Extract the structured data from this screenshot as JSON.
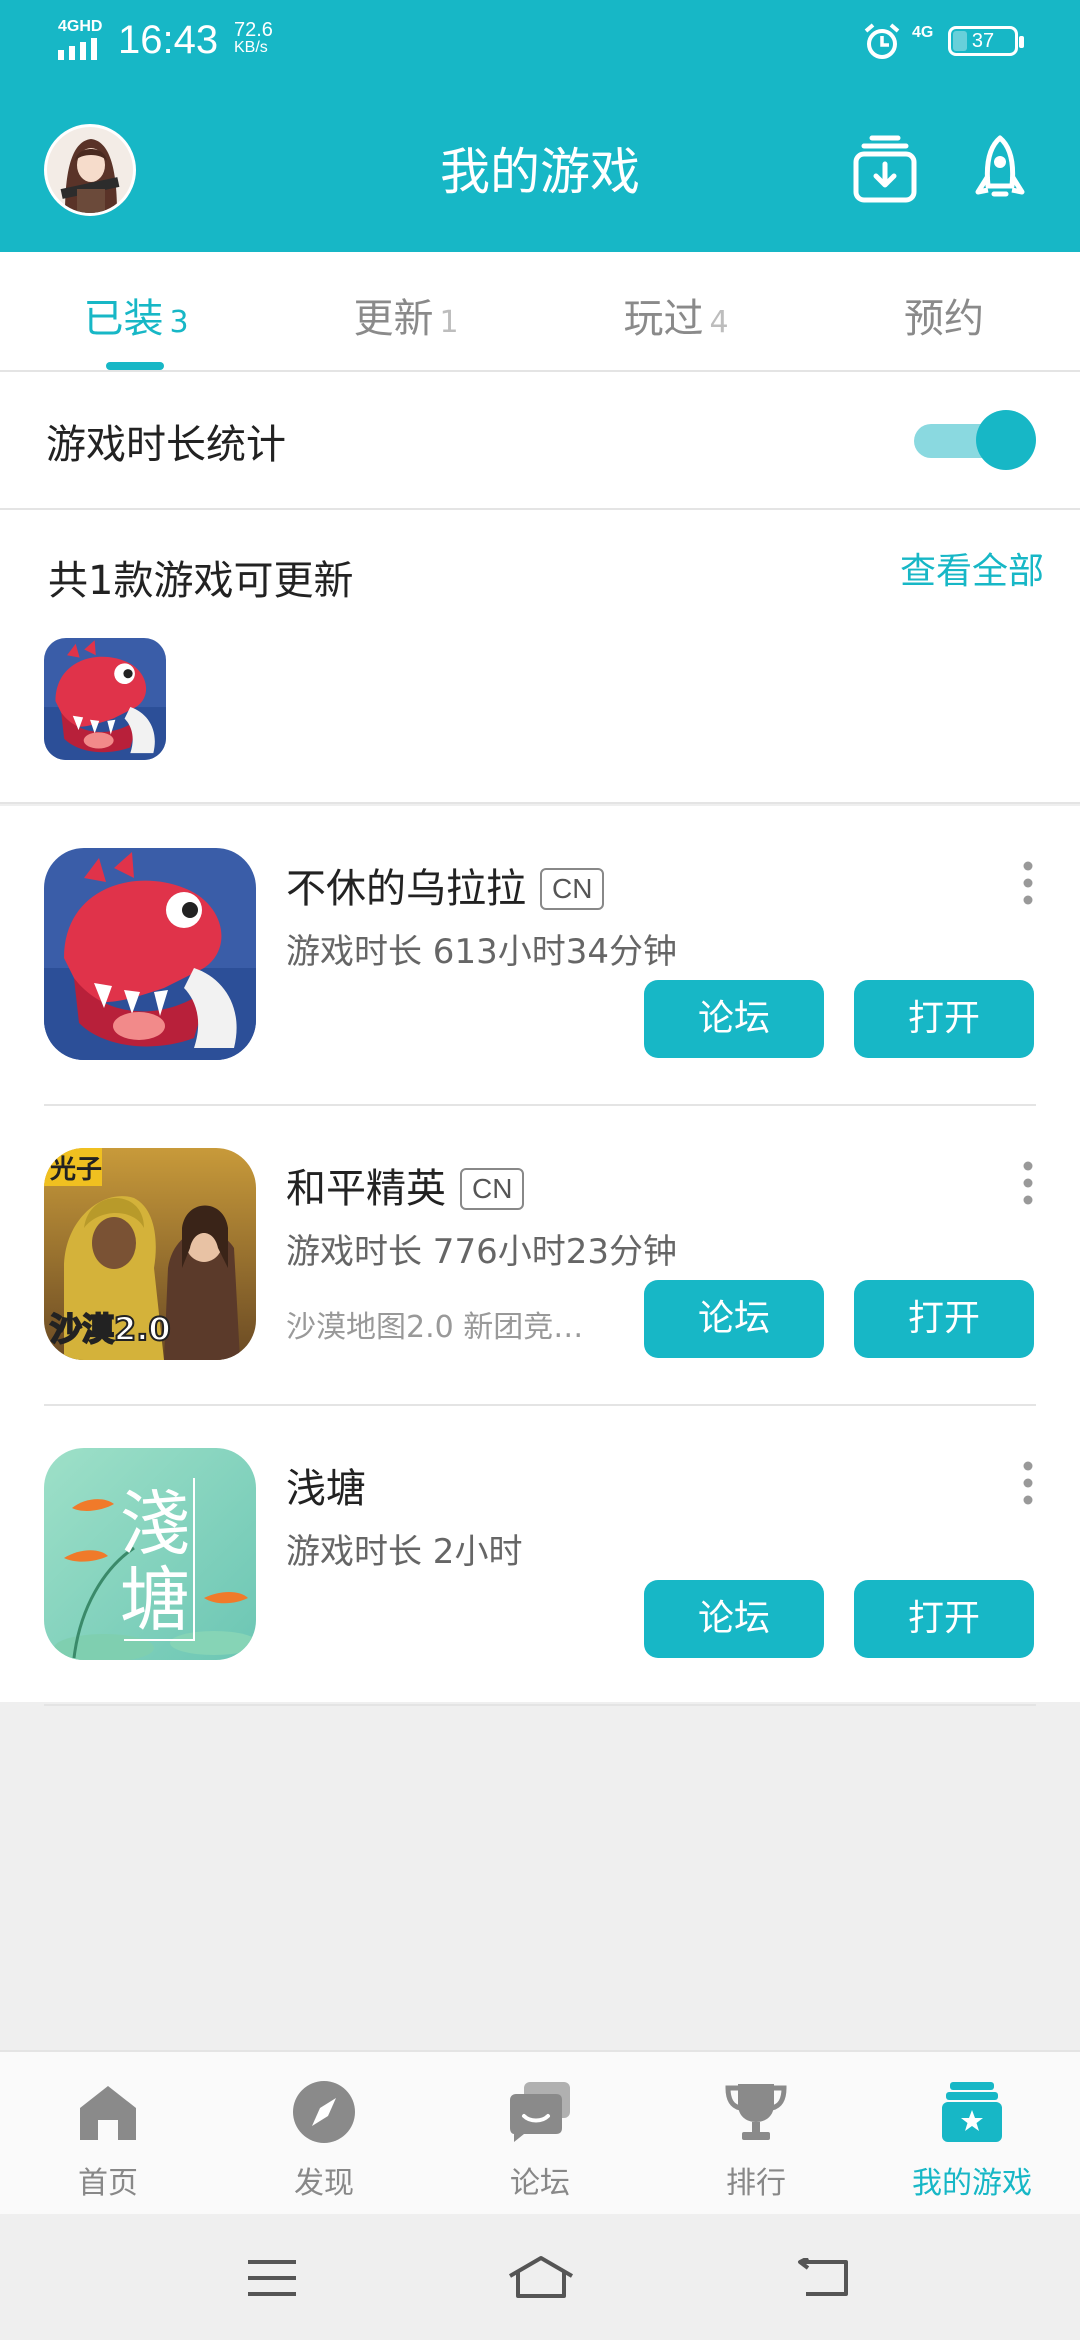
{
  "status_bar": {
    "network_label": "4GHD",
    "time": "16:43",
    "speed_value": "72.6",
    "speed_unit": "KB/s",
    "network_right": "4G",
    "battery": "37",
    "battery_level_pct": 37
  },
  "header": {
    "title": "我的游戏",
    "bg_color": "#17b7c6"
  },
  "tabs": [
    {
      "label": "已装",
      "count": "3",
      "active": true
    },
    {
      "label": "更新",
      "count": "1",
      "active": false
    },
    {
      "label": "玩过",
      "count": "4",
      "active": false
    },
    {
      "label": "预约",
      "count": "",
      "active": false
    }
  ],
  "stats": {
    "label": "游戏时长统计",
    "toggle_on": true
  },
  "update_section": {
    "title": "共1款游戏可更新",
    "view_all": "查看全部"
  },
  "games": [
    {
      "name": "不休的乌拉拉",
      "badge": "CN",
      "time": "游戏时长 613小时34分钟",
      "subtitle": "",
      "forum": "论坛",
      "open": "打开"
    },
    {
      "name": "和平精英",
      "badge": "CN",
      "time": "游戏时长 776小时23分钟",
      "subtitle": "沙漠地图2.0 新团竞…",
      "forum": "论坛",
      "open": "打开"
    },
    {
      "name": "浅塘",
      "badge": "",
      "time": "游戏时长 2小时",
      "subtitle": "",
      "forum": "论坛",
      "open": "打开",
      "icon_text": "淺塘"
    }
  ],
  "game_art": {
    "pubg_tag": "光子",
    "pubg_map": "沙漠2.0"
  },
  "bottom_nav": [
    {
      "label": "首页",
      "icon": "home-icon",
      "active": false
    },
    {
      "label": "发现",
      "icon": "compass-icon",
      "active": false
    },
    {
      "label": "论坛",
      "icon": "forum-icon",
      "active": false
    },
    {
      "label": "排行",
      "icon": "trophy-icon",
      "active": false
    },
    {
      "label": "我的游戏",
      "icon": "my-games-icon",
      "active": true
    }
  ],
  "colors": {
    "accent": "#17b7c6",
    "background": "#efefef"
  }
}
